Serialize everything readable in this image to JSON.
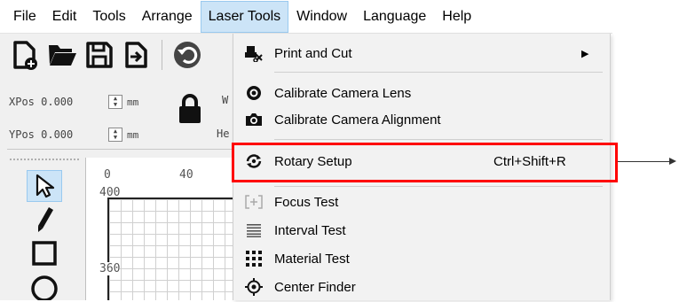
{
  "menubar": {
    "items": [
      "File",
      "Edit",
      "Tools",
      "Arrange",
      "Laser Tools",
      "Window",
      "Language",
      "Help"
    ],
    "active": "Laser Tools"
  },
  "toolbar": {
    "icons": [
      "new-file-icon",
      "open-folder-icon",
      "save-icon",
      "import-icon",
      "undo-icon"
    ]
  },
  "position": {
    "x_label": "XPos 0.000",
    "y_label": "YPos 0.000",
    "x_unit": "mm",
    "y_unit": "mm",
    "w_cut": "W",
    "h_cut": "He"
  },
  "ruler": {
    "top_ticks": [
      "0",
      "40"
    ],
    "left_ticks": [
      "400",
      "360"
    ]
  },
  "tools": {
    "icons": [
      "select-arrow-icon",
      "pencil-icon",
      "rectangle-icon",
      "ellipse-icon"
    ]
  },
  "laser_tools_menu": {
    "items": [
      {
        "label": "Print and Cut",
        "shortcut": "",
        "submenu": true,
        "icon": "print-and-cut-icon"
      },
      {
        "label": "Calibrate Camera Lens",
        "shortcut": "",
        "submenu": false,
        "icon": "camera-lens-icon"
      },
      {
        "label": "Calibrate Camera Alignment",
        "shortcut": "",
        "submenu": false,
        "icon": "camera-icon"
      },
      {
        "label": "Rotary Setup",
        "shortcut": "Ctrl+Shift+R",
        "submenu": false,
        "icon": "rotary-icon"
      },
      {
        "label": "Focus Test",
        "shortcut": "",
        "submenu": false,
        "icon": "focus-test-icon"
      },
      {
        "label": "Interval Test",
        "shortcut": "",
        "submenu": false,
        "icon": "interval-test-icon"
      },
      {
        "label": "Material Test",
        "shortcut": "",
        "submenu": false,
        "icon": "material-test-icon"
      },
      {
        "label": "Center Finder",
        "shortcut": "",
        "submenu": false,
        "icon": "center-finder-icon"
      }
    ]
  },
  "colors": {
    "highlight": "#ff0000",
    "menu_active_bg": "#cce4f7"
  }
}
